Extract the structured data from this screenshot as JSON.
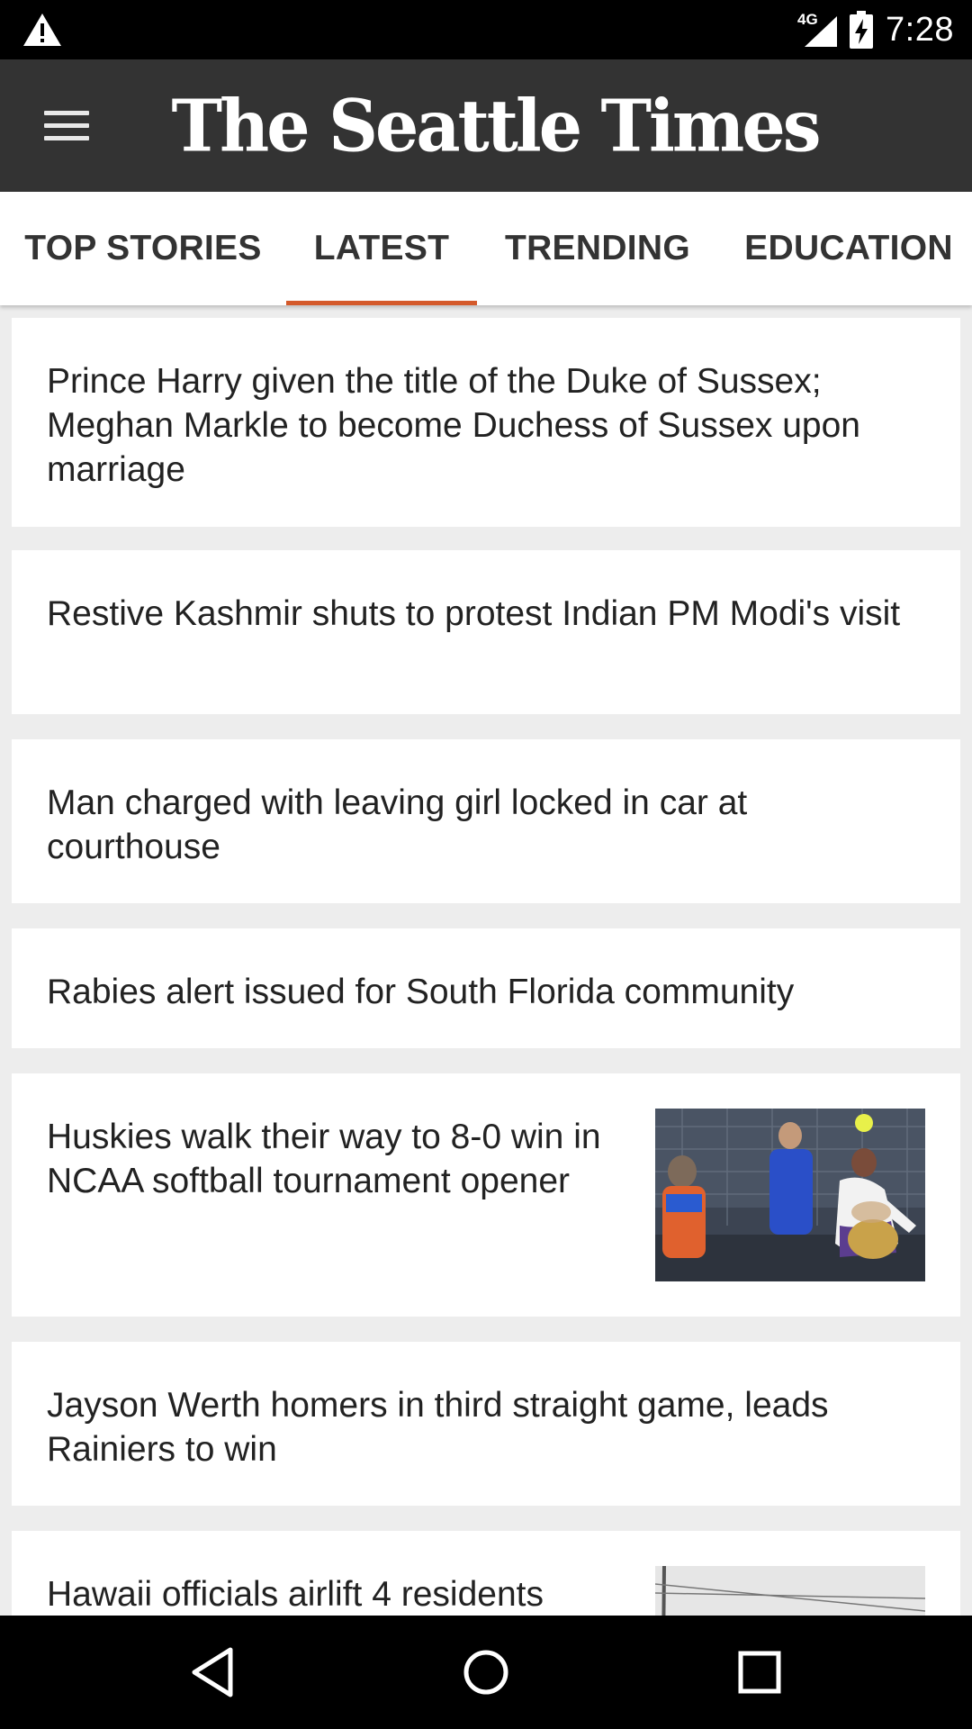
{
  "status_bar": {
    "network": "4G",
    "time": "7:28"
  },
  "app_bar": {
    "masthead": "The Seattle Times"
  },
  "tabs": [
    {
      "label": "TOP STORIES",
      "selected": false
    },
    {
      "label": "LATEST",
      "selected": true
    },
    {
      "label": "TRENDING",
      "selected": false
    },
    {
      "label": "EDUCATION",
      "selected": false
    }
  ],
  "colors": {
    "app_bar": "#333333",
    "tab_indicator": "#d45a2b",
    "feed_background": "#ededed"
  },
  "stories": [
    {
      "headline": "Prince Harry given the title of the Duke of Sussex; Meghan Markle to become Duchess of Sussex upon marriage",
      "has_thumbnail": false
    },
    {
      "headline": "Restive Kashmir shuts to protest Indian PM Modi's visit",
      "has_thumbnail": false
    },
    {
      "headline": "Man charged with leaving girl locked in car at courthouse",
      "has_thumbnail": false
    },
    {
      "headline": "Rabies alert issued for South Florida community",
      "has_thumbnail": false
    },
    {
      "headline": "Huskies walk their way to 8-0 win in NCAA softball tournament opener",
      "has_thumbnail": true
    },
    {
      "headline": "Jayson Werth homers in third straight game, leads Rainiers to win",
      "has_thumbnail": false
    },
    {
      "headline": "Hawaii officials airlift 4 residents",
      "has_thumbnail": true
    }
  ],
  "navigation": {
    "icons": [
      "back-icon",
      "home-icon",
      "recents-icon"
    ]
  }
}
